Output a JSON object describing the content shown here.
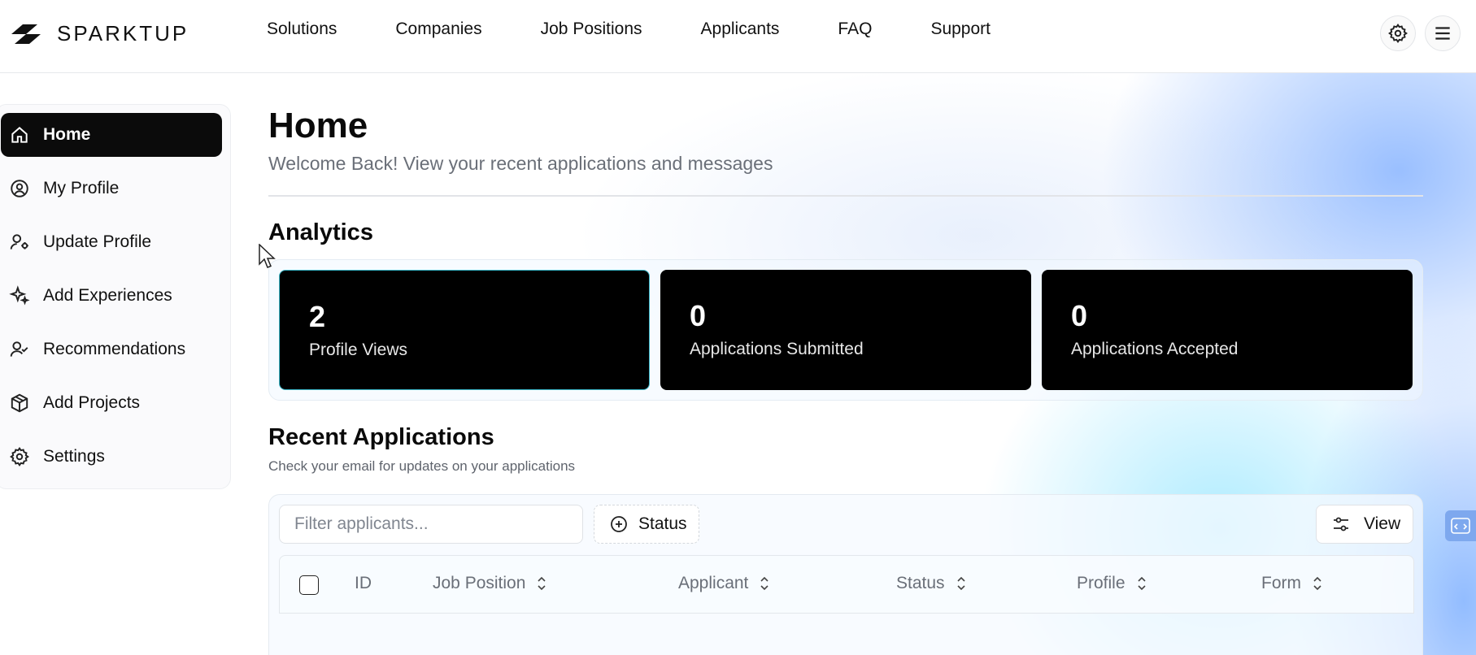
{
  "brand": {
    "name": "SPARKTUP"
  },
  "nav": [
    "Solutions",
    "Companies",
    "Job Positions",
    "Applicants",
    "FAQ",
    "Support"
  ],
  "header_icons": {
    "settings": "gear-icon",
    "menu": "hamburger-menu-icon"
  },
  "sidebar": {
    "active": "Home",
    "items": [
      {
        "label": "Home",
        "icon": "home-icon"
      },
      {
        "label": "My Profile",
        "icon": "user-circle-icon"
      },
      {
        "label": "Update Profile",
        "icon": "user-cog-icon"
      },
      {
        "label": "Add Experiences",
        "icon": "sparkles-icon"
      },
      {
        "label": "Recommendations",
        "icon": "user-check-icon"
      },
      {
        "label": "Add Projects",
        "icon": "package-icon"
      },
      {
        "label": "Settings",
        "icon": "gear-icon"
      }
    ]
  },
  "page": {
    "title": "Home",
    "subtitle": "Welcome Back! View your recent applications and messages"
  },
  "analytics": {
    "title": "Analytics",
    "cards": [
      {
        "value": "2",
        "label": "Profile Views"
      },
      {
        "value": "0",
        "label": "Applications Submitted"
      },
      {
        "value": "0",
        "label": "Applications Accepted"
      }
    ]
  },
  "recent": {
    "title": "Recent Applications",
    "subtitle": "Check your email for updates on your applications",
    "filter_placeholder": "Filter applicants...",
    "status_label": "Status",
    "view_label": "View",
    "columns": [
      "ID",
      "Job Position",
      "Applicant",
      "Status",
      "Profile",
      "Form"
    ]
  },
  "colors": {
    "accent": "#3bb7c9",
    "card_bg": "#000000",
    "sidebar_active": "#0b0b0b"
  }
}
